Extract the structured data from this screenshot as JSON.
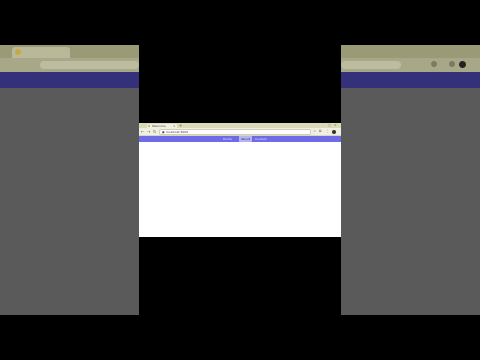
{
  "browser": {
    "tab_title": "Welcome",
    "tab_close": "×",
    "new_tab": "+",
    "url": "localhost:3000",
    "lock_icon": "lock-icon",
    "back": "←",
    "forward": "→",
    "reload": "↻",
    "minimize": "–",
    "maximize": "□",
    "close": "×",
    "star": "☆",
    "menu": "⋮",
    "extension": "⧉"
  },
  "site_nav": {
    "links": [
      "Home",
      "About",
      "Contact"
    ],
    "active_index": 1
  },
  "colors": {
    "nav_band": "#6f6ae6",
    "nav_active": "#b7b4f5",
    "tab_bar": "#dcd9ba",
    "letterbox": "#000000",
    "side_panel": "#5a5a5a"
  }
}
